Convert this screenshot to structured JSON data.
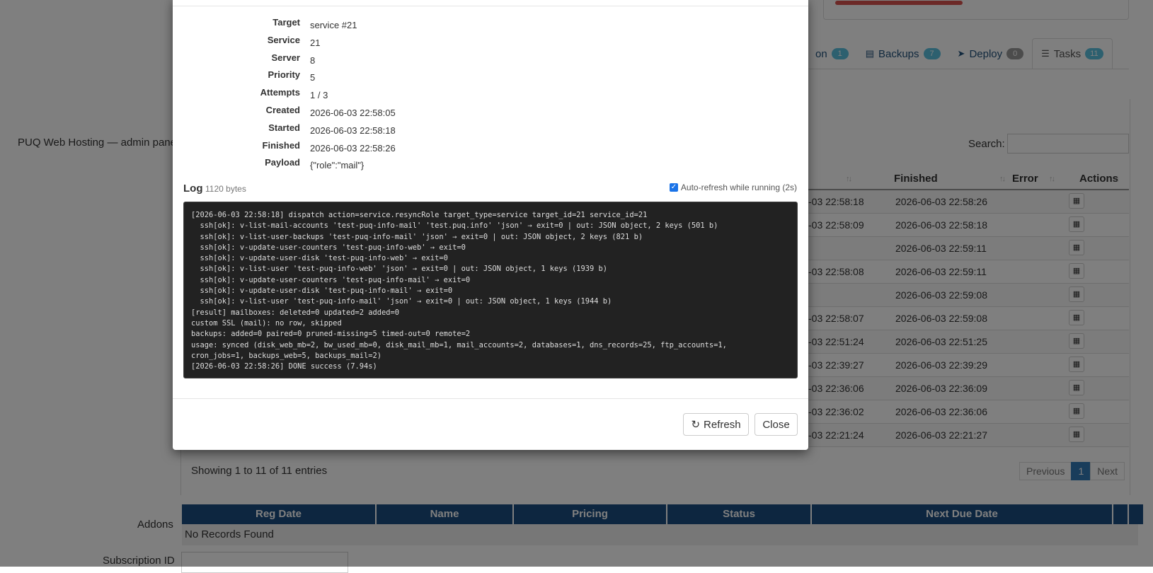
{
  "background": {
    "brand": "PUQ Web Hosting — admin panel",
    "tabs": [
      {
        "label": "on",
        "icon": "",
        "count": "1",
        "badge_color": "#5bc0de"
      },
      {
        "label": "Backups",
        "icon": "database-icon",
        "count": "7",
        "badge_color": "#5bc0de"
      },
      {
        "label": "Deploy",
        "icon": "rocket-icon",
        "count": "0",
        "badge_color": "#999999"
      },
      {
        "label": "Tasks",
        "icon": "list-icon",
        "count": "11",
        "badge_color": "#5bc0de"
      }
    ],
    "search_label": "Search:",
    "columns": [
      "Finished",
      "Error",
      "Actions"
    ],
    "rows": [
      {
        "started": "-03 22:58:18",
        "finished": "2026-06-03 22:58:26"
      },
      {
        "started": "-03 22:58:09",
        "finished": "2026-06-03 22:58:18"
      },
      {
        "started": "",
        "finished": "2026-06-03 22:59:11"
      },
      {
        "started": "-03 22:58:08",
        "finished": "2026-06-03 22:59:11"
      },
      {
        "started": "",
        "finished": "2026-06-03 22:59:08"
      },
      {
        "started": "-03 22:58:07",
        "finished": "2026-06-03 22:59:08"
      },
      {
        "started": "-03 22:51:24",
        "finished": "2026-06-03 22:51:25"
      },
      {
        "started": "-03 22:39:27",
        "finished": "2026-06-03 22:39:29"
      },
      {
        "started": "-03 22:36:06",
        "finished": "2026-06-03 22:36:09"
      },
      {
        "started": "-03 22:36:02",
        "finished": "2026-06-03 22:36:06"
      },
      {
        "started": "-03 22:21:24",
        "finished": "2026-06-03 22:21:27"
      }
    ],
    "showing": "Showing 1 to 11 of 11 entries",
    "pager": {
      "previous": "Previous",
      "current": "1",
      "next": "Next"
    },
    "addons_label": "Addons",
    "addons_columns": [
      "Reg Date",
      "Name",
      "Pricing",
      "Status",
      "Next Due Date"
    ],
    "no_records": "No Records Found",
    "subscription_label": "Subscription ID"
  },
  "modal": {
    "fields": [
      {
        "label": "Target",
        "value": "service #21"
      },
      {
        "label": "Service",
        "value": "21"
      },
      {
        "label": "Server",
        "value": "8"
      },
      {
        "label": "Priority",
        "value": "5"
      },
      {
        "label": "Attempts",
        "value": "1 / 3"
      },
      {
        "label": "Created",
        "value": "2026-06-03 22:58:05"
      },
      {
        "label": "Started",
        "value": "2026-06-03 22:58:18"
      },
      {
        "label": "Finished",
        "value": "2026-06-03 22:58:26"
      },
      {
        "label": "Payload",
        "value": "{\"role\":\"mail\"}"
      }
    ],
    "log_title": "Log",
    "log_bytes": "1120 bytes",
    "auto_refresh_label": "Auto-refresh while running (2s)",
    "auto_refresh_checked": true,
    "log_text": "[2026-06-03 22:58:18] dispatch action=service.resyncRole target_type=service target_id=21 service_id=21\n  ssh[ok]: v-list-mail-accounts 'test-puq-info-mail' 'test.puq.info' 'json' → exit=0 | out: JSON object, 2 keys (501 b)\n  ssh[ok]: v-list-user-backups 'test-puq-info-mail' 'json' → exit=0 | out: JSON object, 2 keys (821 b)\n  ssh[ok]: v-update-user-counters 'test-puq-info-web' → exit=0\n  ssh[ok]: v-update-user-disk 'test-puq-info-web' → exit=0\n  ssh[ok]: v-list-user 'test-puq-info-web' 'json' → exit=0 | out: JSON object, 1 keys (1939 b)\n  ssh[ok]: v-update-user-counters 'test-puq-info-mail' → exit=0\n  ssh[ok]: v-update-user-disk 'test-puq-info-mail' → exit=0\n  ssh[ok]: v-list-user 'test-puq-info-mail' 'json' → exit=0 | out: JSON object, 1 keys (1944 b)\n[result] mailboxes: deleted=0 updated=2 added=0\ncustom SSL (mail): no row, skipped\nbackups: added=0 paired=0 pruned-missing=5 timed-out=0 remote=2\nusage: synced (disk_web_mb=2, bw_used_mb=0, disk_mail_mb=1, mail_accounts=2, databases=1, dns_records=25, ftp_accounts=1,\ncron_jobs=1, backups_web=5, backups_mail=2)\n[2026-06-03 22:58:26] DONE success (7.94s)",
    "refresh_label": "Refresh",
    "close_label": "Close"
  }
}
